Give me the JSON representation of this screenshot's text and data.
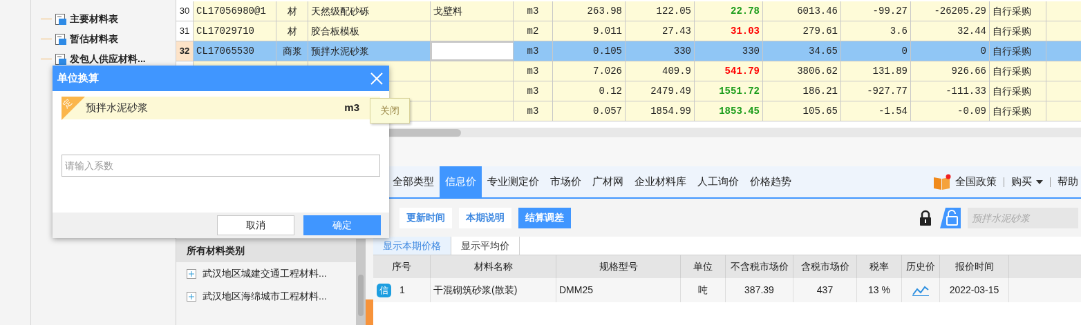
{
  "sidebar": {
    "items": [
      {
        "label": "主要材料表"
      },
      {
        "label": "暂估材料表"
      },
      {
        "label": "发包人供应材料..."
      }
    ]
  },
  "table": {
    "rows": [
      {
        "row_number": "30",
        "column_1": "CL17056980@1",
        "column_2": "材",
        "column_3": "天然级配砂砾",
        "column_4": "戈壁料",
        "column_5": "m3",
        "column_6": "263.98",
        "column_7": "122.05",
        "column_8": "22.78",
        "column_9": "6013.46",
        "column_10": "-99.27",
        "column_11": "-26205.29",
        "column_12": "自行采购",
        "selected": false,
        "color": "#1a9c1a"
      },
      {
        "row_number": "31",
        "column_1": "CL17029710",
        "column_2": "材",
        "column_3": "胶合板模板",
        "column_5": "m2",
        "column_6": "9.011",
        "column_7": "27.43",
        "column_8": "31.03",
        "column_9": "279.61",
        "column_10": "3.6",
        "column_11": "32.44",
        "column_12": "自行采购",
        "selected": false,
        "color": "#ff0000"
      },
      {
        "row_number": "32",
        "column_1": "CL17065530",
        "column_2": "商浆",
        "column_3": "预拌水泥砂浆",
        "column_5": "m3",
        "column_6": "0.105",
        "column_7": "330",
        "column_8": "330",
        "column_9": "34.65",
        "column_10": "0",
        "column_11": "0",
        "column_12": "自行采购",
        "selected": true
      },
      {
        "column_5": "m3",
        "column_6": "7.026",
        "column_7": "409.9",
        "column_8": "541.79",
        "column_9": "3806.62",
        "column_10": "131.89",
        "column_11": "926.66",
        "column_12": "自行采购",
        "selected": false,
        "color": "#ff0000"
      },
      {
        "column_5": "m3",
        "column_6": "0.12",
        "column_7": "2479.49",
        "column_8": "1551.72",
        "column_9": "186.21",
        "column_10": "-927.77",
        "column_11": "-111.33",
        "column_12": "自行采购",
        "selected": false,
        "color": "#1a9c1a"
      },
      {
        "column_5": "m3",
        "column_6": "0.057",
        "column_7": "1854.99",
        "column_8": "1853.45",
        "column_9": "105.65",
        "column_10": "-1.54",
        "column_11": "-0.09",
        "column_12": "自行采购",
        "selected": false,
        "color": "#1a9c1a"
      }
    ]
  },
  "category_panel": {
    "title": "所有材料类别",
    "items": [
      {
        "label": "武汉地区城建交通工程材料..."
      },
      {
        "label": "武汉地区海绵城市工程材料..."
      }
    ]
  },
  "price_tabs": [
    {
      "label": "全部类型",
      "selected": false
    },
    {
      "label": "信息价",
      "selected": true
    },
    {
      "label": "专业测定价",
      "selected": false
    },
    {
      "label": "市场价",
      "selected": false
    },
    {
      "label": "广材网",
      "selected": false
    },
    {
      "label": "企业材料库",
      "selected": false
    },
    {
      "label": "人工询价",
      "selected": false
    },
    {
      "label": "价格趋势",
      "selected": false
    }
  ],
  "header_links": {
    "policy": "全国政策",
    "buy": "购买",
    "help": "帮助"
  },
  "toolbar": {
    "buttons": [
      {
        "label": "更新时间",
        "selected": false
      },
      {
        "label": "本期说明",
        "selected": false
      },
      {
        "label": "结算调差",
        "selected": true
      }
    ],
    "search": {
      "placeholder": "预拌水泥砂浆"
    }
  },
  "sub_tabs": [
    {
      "label": "显示本期价格",
      "selected": true
    },
    {
      "label": "显示平均价",
      "selected": false
    }
  ],
  "price_table": {
    "columns": [
      "序号",
      "材料名称",
      "规格型号",
      "单位",
      "不含税市场价",
      "含税市场价",
      "税率",
      "历史价",
      "报价时间"
    ],
    "rows": [
      {
        "badge": "信",
        "index": "1",
        "name": "干混砌筑砂浆(散装)",
        "spec": "DMM25",
        "unit": "吨",
        "price_excl_tax": "387.39",
        "price_incl_tax": "437",
        "tax_rate": "13 %",
        "quote_date": "2022-03-15"
      }
    ]
  },
  "dialog": {
    "title": "单位换算",
    "item": {
      "badge": "定",
      "name": "预拌水泥砂浆",
      "unit": "m3"
    },
    "input": {
      "placeholder": "请输入系数"
    },
    "cancel": "取消",
    "confirm": "确定"
  },
  "tooltip": "关闭"
}
